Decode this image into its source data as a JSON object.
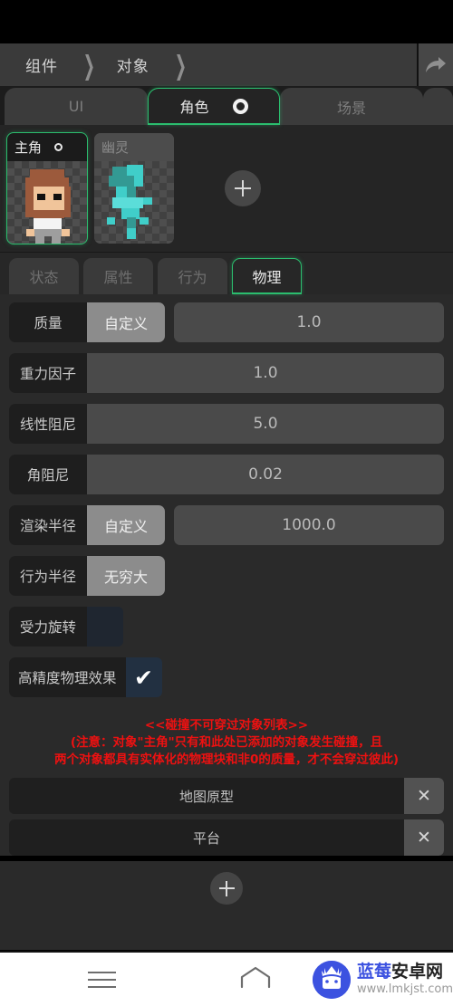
{
  "breadcrumb": {
    "items": [
      "组件",
      "对象"
    ],
    "separator": "❯",
    "share_icon": "share-arrow-icon"
  },
  "top_tabs": {
    "items": [
      {
        "label": "UI",
        "active": false
      },
      {
        "label": "角色",
        "active": true,
        "badge_icon": "ring-icon"
      },
      {
        "label": "场景",
        "active": false
      }
    ]
  },
  "objects": {
    "cards": [
      {
        "name": "主角",
        "selected": true,
        "sprite": "hero-sprite"
      },
      {
        "name": "幽灵",
        "selected": false,
        "sprite": "ghost-sprite"
      }
    ],
    "add_label": "+",
    "add_icon": "plus-icon"
  },
  "prop_tabs": {
    "items": [
      {
        "label": "状态",
        "active": false
      },
      {
        "label": "属性",
        "active": false
      },
      {
        "label": "行为",
        "active": false
      },
      {
        "label": "物理",
        "active": true
      }
    ]
  },
  "properties": [
    {
      "label": "质量",
      "mode": "自定义",
      "value": "1.0",
      "kind": "mode-value"
    },
    {
      "label": "重力因子",
      "mode": null,
      "value": "1.0",
      "kind": "value"
    },
    {
      "label": "线性阻尼",
      "mode": null,
      "value": "5.0",
      "kind": "value"
    },
    {
      "label": "角阻尼",
      "mode": null,
      "value": "0.02",
      "kind": "value"
    },
    {
      "label": "渲染半径",
      "mode": "自定义",
      "value": "1000.0",
      "kind": "mode-value"
    },
    {
      "label": "行为半径",
      "mode": "无穷大",
      "value": null,
      "kind": "mode"
    },
    {
      "label": "受力旋转",
      "mode": null,
      "value": null,
      "kind": "checkbox",
      "checked": false
    },
    {
      "label": "高精度物理效果",
      "mode": null,
      "value": null,
      "kind": "checkbox",
      "checked": true,
      "check_glyph": "✔"
    }
  ],
  "warning": {
    "line1": "<<碰撞不可穿过对象列表>>",
    "line2": "(注意：对象\"主角\"只有和此处已添加的对象发生碰撞，且",
    "line3": "两个对象都具有实体化的物理块和非0的质量，才不会穿过彼此)",
    "color": "#ee1111"
  },
  "collide_list": {
    "items": [
      {
        "name": "地图原型",
        "delete_glyph": "✕"
      },
      {
        "name": "平台",
        "delete_glyph": "✕"
      }
    ],
    "add_icon": "plus-icon"
  },
  "bottom_nav": {
    "menu_icon": "hamburger-menu-icon",
    "home_icon": "home-icon",
    "watermark": {
      "logo_icon": "android-robot-icon",
      "name_part1": "蓝莓",
      "name_part2": "安卓网",
      "url": "www.lmkjst.com"
    }
  },
  "theme": {
    "accent": "#2bbd6e",
    "panel_bg": "#2a2a2a",
    "label_bg": "#1e1e1e",
    "value_bg": "#4a4a4a",
    "mode_bg": "#8c8c8c",
    "warn": "#ee1111",
    "watermark_blue": "#3c52e0"
  }
}
